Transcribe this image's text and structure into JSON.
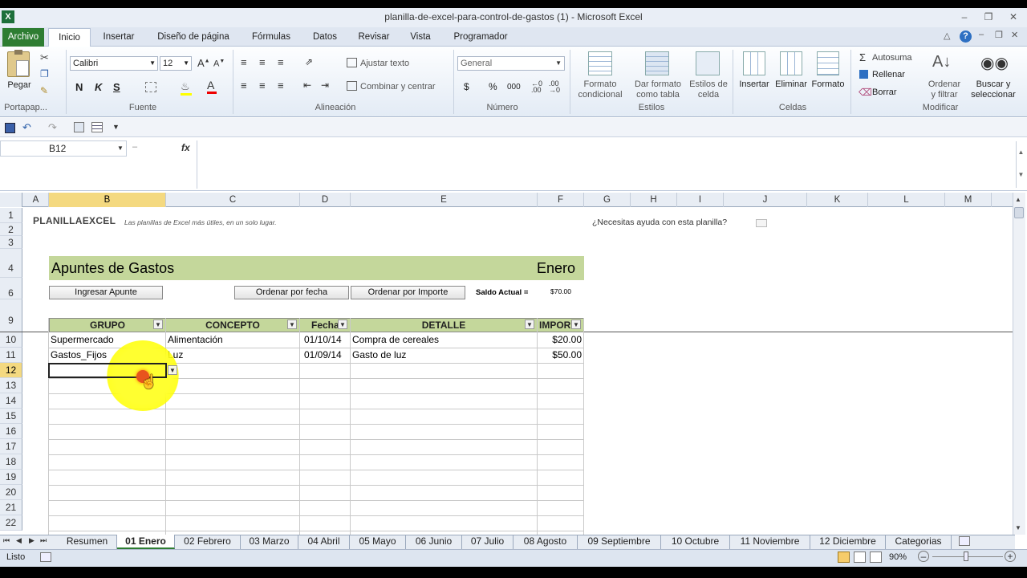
{
  "window": {
    "title": "planilla-de-excel-para-control-de-gastos (1)  -  Microsoft Excel",
    "app_icon": "excel-icon"
  },
  "ribbon_tabs": [
    "Archivo",
    "Inicio",
    "Insertar",
    "Diseño de página",
    "Fórmulas",
    "Datos",
    "Revisar",
    "Vista",
    "Programador"
  ],
  "ribbon": {
    "clipboard": {
      "paste": "Pegar",
      "group": "Portapap..."
    },
    "font": {
      "name": "Calibri",
      "size": "12",
      "bold": "N",
      "italic": "K",
      "underline": "S",
      "group": "Fuente"
    },
    "alignment": {
      "wrap": "Ajustar texto",
      "merge": "Combinar y centrar",
      "group": "Alineación"
    },
    "number": {
      "format": "General",
      "currency": "$",
      "percent": "%",
      "thousands": "000",
      "group": "Número"
    },
    "styles": {
      "cond": [
        "Formato",
        "condicional"
      ],
      "table": [
        "Dar formato",
        "como tabla"
      ],
      "cell": [
        "Estilos de",
        "celda"
      ],
      "group": "Estilos"
    },
    "cells": {
      "insert": "Insertar",
      "delete": "Eliminar",
      "format": "Formato",
      "group": "Celdas"
    },
    "editing": {
      "autosum": "Autosuma",
      "fill": "Rellenar",
      "clear": "Borrar",
      "sort": [
        "Ordenar",
        "y filtrar"
      ],
      "find": [
        "Buscar y",
        "seleccionar"
      ],
      "group": "Modificar"
    }
  },
  "namebox": "B12",
  "fx": "fx",
  "columns": [
    "A",
    "B",
    "C",
    "D",
    "E",
    "F",
    "G",
    "H",
    "I",
    "J",
    "K",
    "L",
    "M"
  ],
  "rows": [
    "1",
    "2",
    "3",
    "4",
    "5",
    "6",
    "7",
    "8",
    "9",
    "10",
    "11",
    "12",
    "13",
    "14",
    "15",
    "16",
    "17",
    "18",
    "19",
    "20",
    "21",
    "22"
  ],
  "sheet": {
    "brand": "PLANILLAEXCEL",
    "tagline": "Las planillas de Excel más útiles, en un solo lugar.",
    "help": "¿Necesitas ayuda con esta planilla?",
    "header_title": "Apuntes de Gastos",
    "month": "Enero",
    "btn_add": "Ingresar Apunte",
    "btn_sort_date": "Ordenar por fecha",
    "btn_sort_amount": "Ordenar por Importe",
    "saldo_label": "Saldo Actual =",
    "saldo_value": "$70.00",
    "table_headers": [
      "GRUPO",
      "CONCEPTO",
      "Fecha",
      "DETALLE",
      "IMPOR"
    ],
    "table_rows": [
      [
        "Supermercado",
        "Alimentación",
        "01/10/14",
        "Compra de cereales",
        "$20.00"
      ],
      [
        "Gastos_Fijos",
        "Luz",
        "01/09/14",
        "Gasto de luz",
        "$50.00"
      ]
    ]
  },
  "sheet_tabs": [
    "Resumen",
    "01 Enero",
    "02 Febrero",
    "03 Marzo",
    "04 Abril",
    "05 Mayo",
    "06 Junio",
    "07 Julio",
    "08 Agosto",
    "09 Septiembre",
    "10 Octubre",
    "11 Noviembre",
    "12 Diciembre",
    "Categorias"
  ],
  "status": {
    "ready": "Listo",
    "zoom": "90%"
  },
  "colors": {
    "accent_green": "#c4d79b",
    "file_tab": "#2e7d32",
    "selection": "#f4d980",
    "cursor_highlight": "#ffff00"
  }
}
